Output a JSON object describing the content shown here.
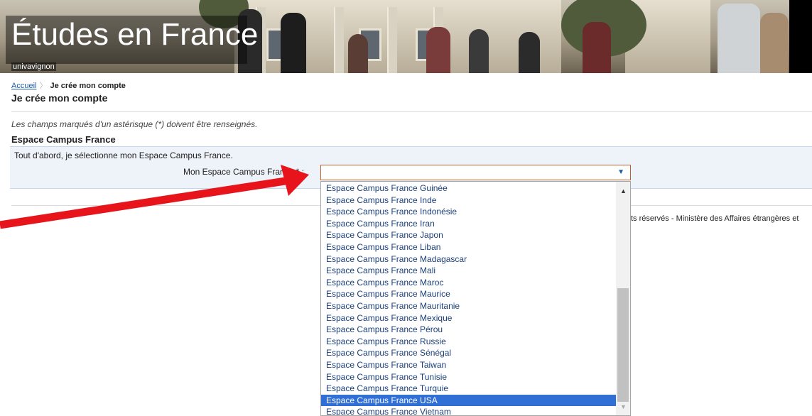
{
  "banner": {
    "title": "Études en France",
    "subtitle": "univavignon"
  },
  "breadcrumb": {
    "home": "Accueil",
    "current": "Je crée mon compte"
  },
  "page_title": "Je crée mon compte",
  "required_note": "Les champs marqués d'un astérisque (*) doivent être renseignés.",
  "section": {
    "title": "Espace Campus France",
    "intro": "Tout d'abord, je sélectionne mon Espace Campus France.",
    "field_label": "Mon Espace Campus France * :",
    "field_value": ""
  },
  "footer_text": "ts réservés - Ministère des Affaires étrangères et",
  "dropdown": {
    "selected_index": 19,
    "options": [
      "Espace Campus France Guinée",
      "Espace Campus France Inde",
      "Espace Campus France Indonésie",
      "Espace Campus France Iran",
      "Espace Campus France Japon",
      "Espace Campus France Liban",
      "Espace Campus France Madagascar",
      "Espace Campus France Mali",
      "Espace Campus France Maroc",
      "Espace Campus France Maurice",
      "Espace Campus France Mauritanie",
      "Espace Campus France Mexique",
      "Espace Campus France Pérou",
      "Espace Campus France Russie",
      "Espace Campus France Sénégal",
      "Espace Campus France Taiwan",
      "Espace Campus France Tunisie",
      "Espace Campus France Turquie",
      "Espace Campus France USA",
      "Espace Campus France Vietnam"
    ]
  },
  "colors": {
    "arrow": "#e8141b",
    "selection": "#2f6fd6",
    "link": "#1a5aa6"
  }
}
